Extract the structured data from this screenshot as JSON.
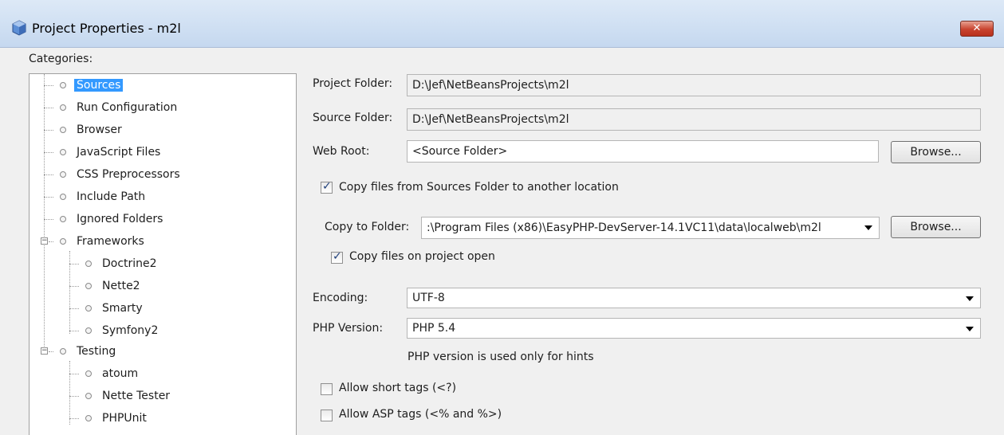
{
  "window": {
    "title": "Project Properties - m2l",
    "close_label": "✕"
  },
  "categories_label": "Categories:",
  "tree": {
    "sources": "Sources",
    "run_configuration": "Run Configuration",
    "browser": "Browser",
    "javascript_files": "JavaScript Files",
    "css_preprocessors": "CSS Preprocessors",
    "include_path": "Include Path",
    "ignored_folders": "Ignored Folders",
    "frameworks": "Frameworks",
    "doctrine2": "Doctrine2",
    "nette2": "Nette2",
    "smarty": "Smarty",
    "symfony2": "Symfony2",
    "testing": "Testing",
    "atoum": "atoum",
    "nette_tester": "Nette Tester",
    "phpunit": "PHPUnit"
  },
  "form": {
    "project_folder_label": "Project Folder:",
    "project_folder_value": "D:\\Jef\\NetBeansProjects\\m2l",
    "source_folder_label": "Source Folder:",
    "source_folder_value": "D:\\Jef\\NetBeansProjects\\m2l",
    "web_root_label": "Web Root:",
    "web_root_value": "<Source Folder>",
    "browse_label": "Browse...",
    "copy_files_label": "Copy files from Sources Folder to another location",
    "copy_to_folder_label": "Copy to Folder:",
    "copy_to_folder_value": ":\\Program Files (x86)\\EasyPHP-DevServer-14.1VC11\\data\\localweb\\m2l",
    "copy_on_open_label": "Copy files on project open",
    "encoding_label": "Encoding:",
    "encoding_value": "UTF-8",
    "php_version_label": "PHP Version:",
    "php_version_value": "PHP 5.4",
    "php_hint": "PHP version is used only for hints",
    "allow_short_tags_label": "Allow short tags (<?)",
    "allow_asp_tags_label": "Allow ASP tags (<% and %>)"
  },
  "state": {
    "copy_files_checked": true,
    "copy_on_open_checked": true,
    "allow_short_tags_checked": false,
    "allow_asp_tags_checked": false
  }
}
